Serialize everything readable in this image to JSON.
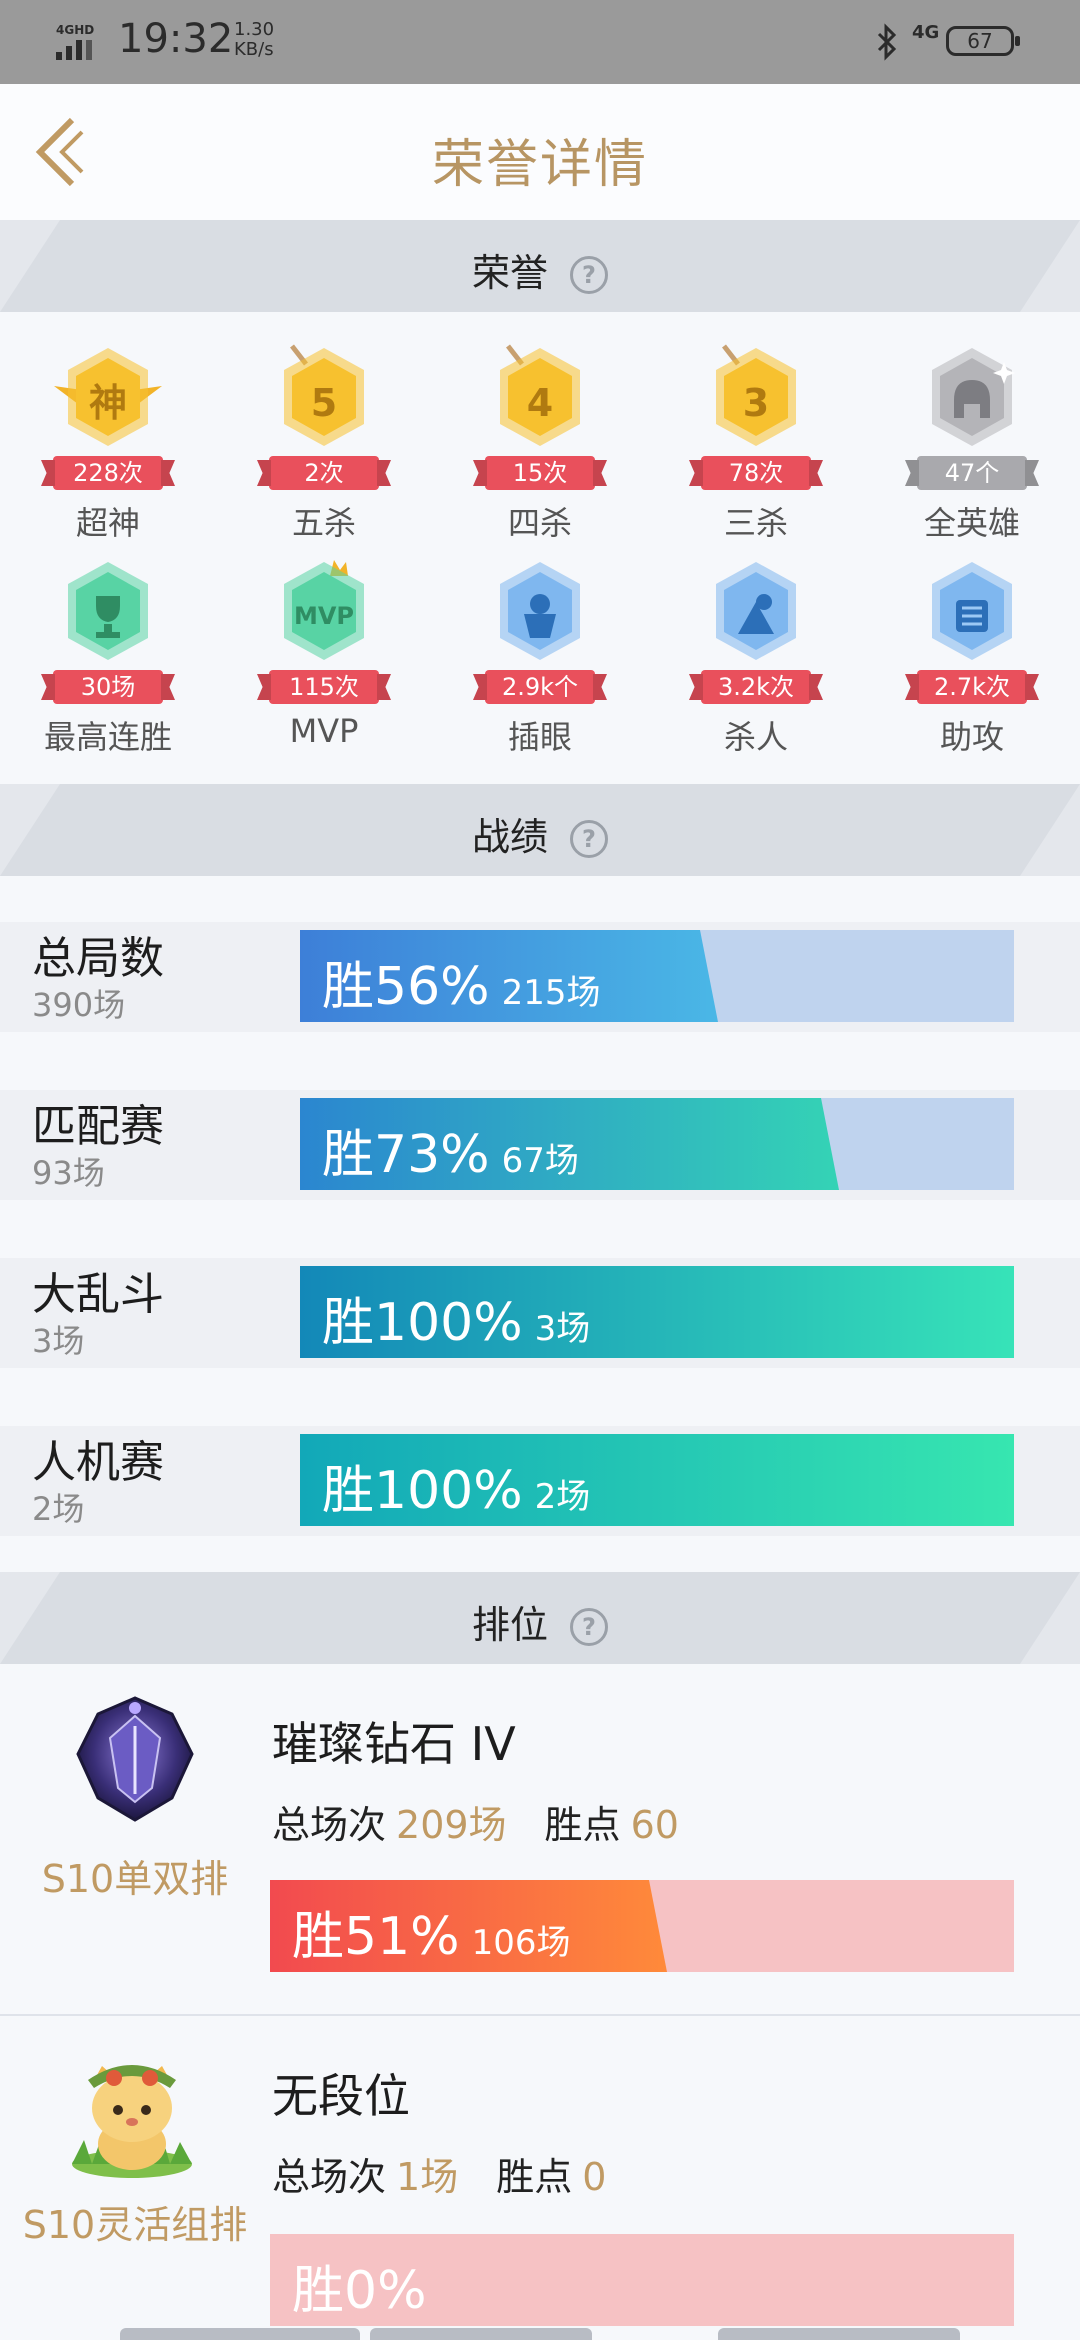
{
  "status_bar": {
    "time": "19:32",
    "speed_value": "1.30",
    "speed_unit": "KB/s",
    "network_left": "4GHD",
    "network_right": "4G",
    "battery": "67"
  },
  "nav": {
    "title": "荣誉详情",
    "back_icon": "chevron-left-icon"
  },
  "sections": {
    "honor": "荣誉",
    "record": "战绩",
    "rank": "排位"
  },
  "honors": [
    {
      "label": "超神",
      "count": "228次",
      "glyph": "神",
      "color": "#f7c12f",
      "icon": "godlike-badge-icon"
    },
    {
      "label": "五杀",
      "count": "2次",
      "glyph": "5",
      "color": "#f7c12f",
      "icon": "penta-kill-badge-icon"
    },
    {
      "label": "四杀",
      "count": "15次",
      "glyph": "4",
      "color": "#f7c12f",
      "icon": "quadra-kill-badge-icon"
    },
    {
      "label": "三杀",
      "count": "78次",
      "glyph": "3",
      "color": "#f7c12f",
      "icon": "triple-kill-badge-icon"
    },
    {
      "label": "全英雄",
      "count": "47个",
      "glyph": "",
      "color": "#b4b4b8",
      "icon": "all-heroes-badge-icon"
    },
    {
      "label": "最高连胜",
      "count": "30场",
      "glyph": "",
      "color": "#58d3a4",
      "icon": "trophy-badge-icon"
    },
    {
      "label": "MVP",
      "count": "115次",
      "glyph": "MVP",
      "color": "#58d3a4",
      "icon": "mvp-badge-icon"
    },
    {
      "label": "插眼",
      "count": "2.9k个",
      "glyph": "",
      "color": "#7fb7ef",
      "icon": "ward-badge-icon"
    },
    {
      "label": "杀人",
      "count": "3.2k次",
      "glyph": "",
      "color": "#7fb7ef",
      "icon": "kill-badge-icon"
    },
    {
      "label": "助攻",
      "count": "2.7k次",
      "glyph": "",
      "color": "#7fb7ef",
      "icon": "assist-badge-icon"
    }
  ],
  "records": [
    {
      "title": "总局数",
      "total": "390场",
      "pct_text": "胜56%",
      "games": "215场",
      "win_rate": 0.56,
      "gradient": [
        "#3d7fd8",
        "#4ab7e6"
      ]
    },
    {
      "title": "匹配赛",
      "total": "93场",
      "pct_text": "胜73%",
      "games": "67场",
      "win_rate": 0.73,
      "gradient": [
        "#2b86d0",
        "#34d3b5"
      ]
    },
    {
      "title": "大乱斗",
      "total": "3场",
      "pct_text": "胜100%",
      "games": "3场",
      "win_rate": 1.0,
      "gradient": [
        "#1388b8",
        "#37e3b8"
      ]
    },
    {
      "title": "人机赛",
      "total": "2场",
      "pct_text": "胜100%",
      "games": "2场",
      "win_rate": 1.0,
      "gradient": [
        "#12a8b8",
        "#37e6b0"
      ]
    }
  ],
  "ranks": [
    {
      "season": "S10单双排",
      "tier": "璀璨钻石 IV",
      "total_label": "总场次",
      "total_value": "209场",
      "points_label": "胜点",
      "points_value": "60",
      "pct_text": "胜51%",
      "games": "106场",
      "win_rate": 0.51,
      "icon": "diamond-rank-emblem-icon"
    },
    {
      "season": "S10灵活组排",
      "tier": "无段位",
      "total_label": "总场次",
      "total_value": "1场",
      "points_label": "胜点",
      "points_value": "0",
      "pct_text": "胜0%",
      "games": "",
      "win_rate": 0.0,
      "icon": "unranked-cat-icon"
    }
  ]
}
